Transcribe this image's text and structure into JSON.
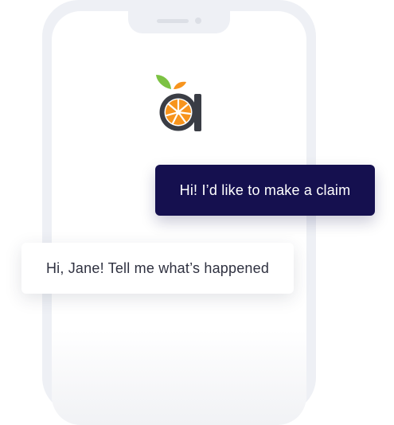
{
  "chat": {
    "user_message": "Hi! I’d like to make a claim",
    "bot_message": "Hi, Jane! Tell me what’s happened"
  },
  "logo": {
    "letter": "a",
    "icon": "orange-slice-logo-icon"
  },
  "colors": {
    "user_bubble": "#15104f",
    "bot_bubble": "#ffffff",
    "logo_dark": "#3a3d45",
    "logo_orange": "#f7941d",
    "logo_leaf": "#7cc243",
    "phone_frame": "#eef0f5"
  }
}
